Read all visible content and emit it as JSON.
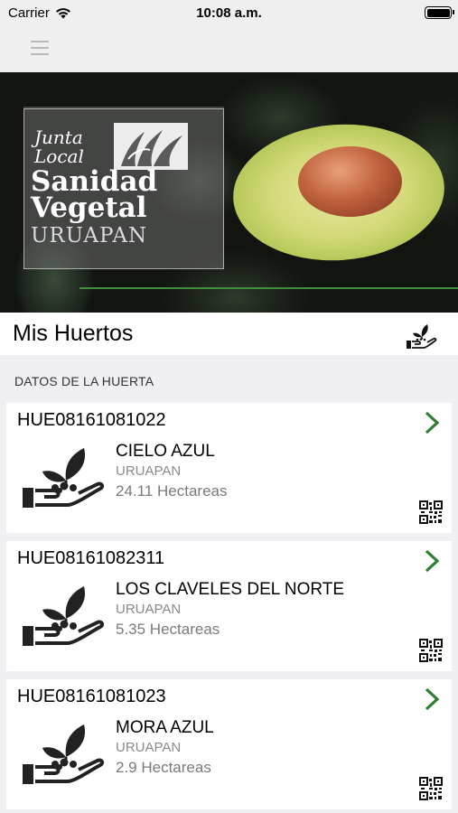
{
  "status_bar": {
    "carrier": "Carrier",
    "time": "10:08 a.m."
  },
  "banner": {
    "logo_line1": "Junta",
    "logo_line2": "Local",
    "logo_line3": "Sanidad",
    "logo_line4": "Vegetal",
    "logo_line5": "URUAPAN"
  },
  "header": {
    "title": "Mis Huertos",
    "action_icon": "hand-plant-icon"
  },
  "section": {
    "label": "DATOS DE LA HUERTA"
  },
  "orchards": [
    {
      "id": "HUE08161081022",
      "name": "CIELO AZUL",
      "city": "URUAPAN",
      "area": "24.11 Hectareas"
    },
    {
      "id": "HUE08161082311",
      "name": "LOS CLAVELES DEL NORTE",
      "city": "URUAPAN",
      "area": "5.35 Hectareas"
    },
    {
      "id": "HUE08161081023",
      "name": "MORA AZUL",
      "city": "URUAPAN",
      "area": "2.9 Hectareas"
    }
  ],
  "colors": {
    "accent_green": "#2e7d32",
    "background": "#efeff4",
    "secondary_text": "#8a8a8a"
  }
}
